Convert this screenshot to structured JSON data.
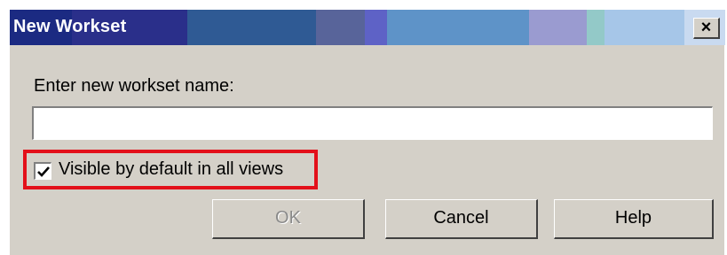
{
  "window": {
    "title": "New Workset",
    "close_label": "×"
  },
  "form": {
    "prompt": "Enter new workset name:",
    "name_value": "",
    "visible_label": "Visible by default in all views",
    "visible_checked": true
  },
  "buttons": {
    "ok": "OK",
    "ok_enabled": false,
    "cancel": "Cancel",
    "help": "Help"
  },
  "annotation": {
    "highlight_color": "#e3101a",
    "highlight_target": "visible-checkbox"
  },
  "colors": {
    "dialog_face": "#d4d0c8",
    "title_text": "#ffffff"
  }
}
